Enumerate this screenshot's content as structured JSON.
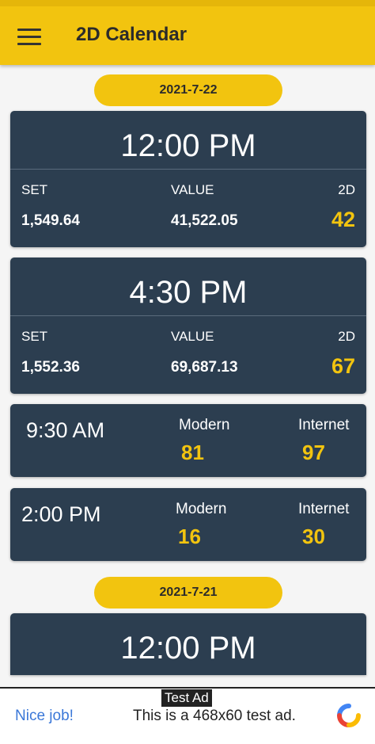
{
  "app_bar": {
    "title": "2D Calendar"
  },
  "days": [
    {
      "date": "2021-7-22",
      "sessions": [
        {
          "time": "12:00 PM",
          "set_label": "SET",
          "value_label": "VALUE",
          "twod_label": "2D",
          "set": "1,549.64",
          "value": "41,522.05",
          "twod": "42"
        },
        {
          "time": "4:30 PM",
          "set_label": "SET",
          "value_label": "VALUE",
          "twod_label": "2D",
          "set": "1,552.36",
          "value": "69,687.13",
          "twod": "67"
        }
      ],
      "rounds": [
        {
          "time": "9:30 AM",
          "modern_label": "Modern",
          "internet_label": "Internet",
          "modern": "81",
          "internet": "97"
        },
        {
          "time": "2:00 PM",
          "modern_label": "Modern",
          "internet_label": "Internet",
          "modern": "16",
          "internet": "30"
        }
      ]
    },
    {
      "date": "2021-7-21",
      "sessions": [
        {
          "time": "12:00 PM"
        }
      ]
    }
  ],
  "ad": {
    "tag": "Test Ad",
    "nice": "Nice job!",
    "text": "This is a 468x60 test ad.",
    "logo_icon": "admob-logo-icon"
  },
  "colors": {
    "accent": "#f2c40f",
    "card": "#2c3e50",
    "number": "#f2c40f"
  }
}
